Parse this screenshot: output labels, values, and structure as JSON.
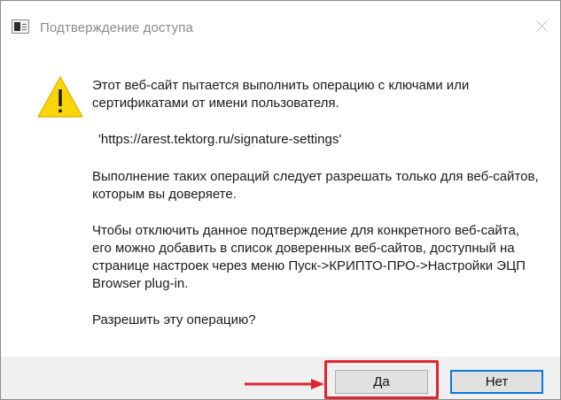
{
  "dialog": {
    "title": "Подтверждение доступа",
    "paragraph1": "Этот веб-сайт пытается выполнить операцию с ключами или сертификатами от имени пользователя.",
    "url": "'https://arest.tektorg.ru/signature-settings'",
    "paragraph2": "Выполнение таких операций следует разрешать только для веб-сайтов, которым вы доверяете.",
    "paragraph3": "Чтобы отключить данное подтверждение для конкретного веб-сайта, его можно добавить в список доверенных веб-сайтов, доступный на странице настроек через меню Пуск->КРИПТО-ПРО->Настройки ЭЦП Browser plug-in.",
    "question": "Разрешить эту операцию?",
    "icons": {
      "app": "app-window-icon",
      "warning": "warning-icon",
      "close": "close-icon"
    }
  },
  "buttons": {
    "yes_label": "Да",
    "no_label": "Нет"
  },
  "annotation": {
    "highlight_color": "#e0242c",
    "arrow_color": "#e0242c"
  }
}
